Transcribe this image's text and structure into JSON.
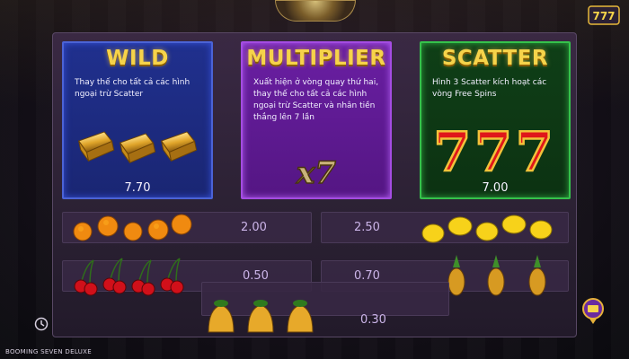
{
  "game": {
    "footer_title": "BOOMING SEVEN DELUXE"
  },
  "cards": {
    "wild": {
      "title": "WILD",
      "desc": "Thay thế cho tất cả các hình ngoại trừ Scatter",
      "value": "7.70"
    },
    "multiplier": {
      "title": "MULTIPLIER",
      "desc": "Xuất hiện ở vòng quay thứ hai, thay thế cho tất cả các hình ngoại trừ Scatter và nhân tiền thắng lên 7 lần",
      "badge": "x7"
    },
    "scatter": {
      "title": "SCATTER",
      "desc": "Hình 3 Scatter kích hoạt các vòng Free Spins",
      "value": "7.00",
      "sevens": "777"
    }
  },
  "paytable": {
    "oranges": "2.00",
    "lemons": "2.50",
    "cherries": "0.50",
    "pineapples": "0.70",
    "bells": "0.30"
  },
  "menu": {
    "sevens": "777"
  },
  "colors": {
    "gold": "#f6d34a",
    "wild_bg": "#1f2e8a",
    "mult_bg": "#601a96",
    "scat_bg": "#0e3a15"
  }
}
